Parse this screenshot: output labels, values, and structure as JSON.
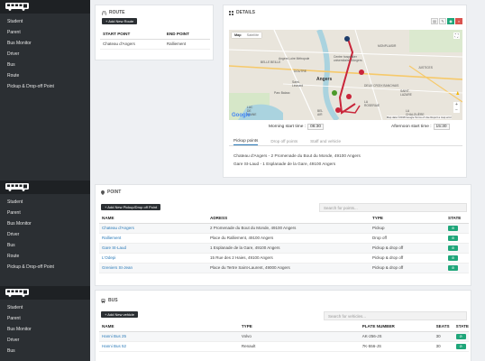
{
  "sidebar": {
    "items": [
      "Student",
      "Parent",
      "Bus Monitor",
      "Driver",
      "Bus",
      "Route",
      "Pickup & Drop-off Point"
    ]
  },
  "route": {
    "title": "ROUTE",
    "add_button": "+ Add New Route",
    "columns": [
      "START POINT",
      "END POINT"
    ],
    "start": "Chateau d'Angers",
    "end": "Ralliement"
  },
  "details": {
    "title": "DETAILS",
    "map_tabs": [
      "Map",
      "Satellite"
    ],
    "map_places": [
      "Angers",
      "MONPLAISIR",
      "BELLE BEILLE",
      "Centre hospitalier universitaire d'Angers",
      "DOUTRE",
      "Angers Loire Métropole",
      "Parc Balzac",
      "LAC DE MAINE",
      "Saint-Léonard",
      "DEUX CROIX BANCHAIS",
      "BEL AIR",
      "LA ROSERAIE",
      "SAINT-LAZARE",
      "JUSTICES",
      "LA CHALOUÈRE"
    ],
    "map_attribution": "Map data ©2018 Google   Terms of Use   Report a map error",
    "google_logo": "Google",
    "morning_label": "Morning start time :",
    "morning_time": "06:30",
    "afternoon_label": "Afternoon start time :",
    "afternoon_time": "15:30",
    "tabs": [
      "Pickup points",
      "Drop off points",
      "Staff and vehicle"
    ],
    "pickup_lines": [
      "Chateau d'Angers - 2 Promenade du Bout du Monde, 49100 Angers",
      "Gare St-Laud - 1 Esplanade de la Gare, 49100 Angers"
    ]
  },
  "point": {
    "title": "POINT",
    "add_button": "+ Add New Pickup/Drop off Point",
    "search_placeholder": "Search for points...",
    "columns": [
      "NAME",
      "ADRESS",
      "TYPE",
      "STATE"
    ],
    "rows": [
      {
        "name": "Chateau d'Angers",
        "address": "2 Promenade du Bout du Monde, 49100 Angers",
        "type": "Pickup"
      },
      {
        "name": "Ralliement",
        "address": "Place du Ralliement, 49100 Angers",
        "type": "Drop off"
      },
      {
        "name": "Gare St-Laud",
        "address": "1 Esplanade de la Gare, 49100 Angers",
        "type": "Pickup & drop off"
      },
      {
        "name": "L'Odepi",
        "address": "15 Rue des 2 Haies, 49100 Angers",
        "type": "Pickup & drop off"
      },
      {
        "name": "Greniers St-Jean",
        "address": "Place du Tertre Saint-Laurent, 49000 Angers",
        "type": "Pickup & drop off"
      }
    ]
  },
  "bus": {
    "title": "BUS",
    "add_button": "+ Add New vehicle",
    "search_placeholder": "Search for vehicles...",
    "columns": [
      "NAME",
      "TYPE",
      "PLATE NUMBER",
      "SEATS",
      "STATE"
    ],
    "rows": [
      {
        "name": "Hanni Bus 25",
        "type": "Volvo",
        "plate": "AK-256-JS",
        "seats": "30"
      },
      {
        "name": "Hanni Bus 52",
        "type": "Renault",
        "plate": "7K-556-JS",
        "seats": "30"
      }
    ]
  },
  "colors": {
    "sidebar": "#2b2f33",
    "accent": "#1fa67a",
    "link": "#2a7ab8",
    "route": "#c9253a"
  }
}
